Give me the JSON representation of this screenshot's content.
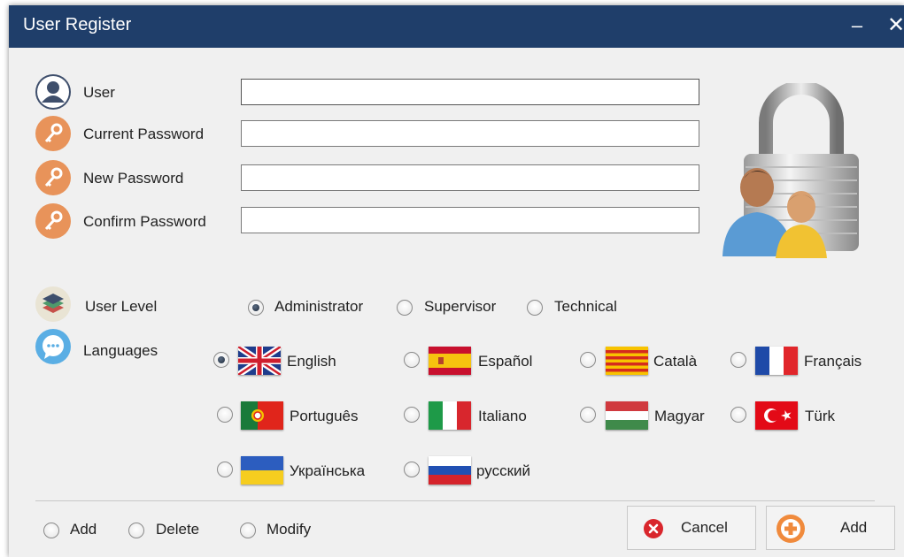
{
  "window": {
    "title": "User Register",
    "minimize_glyph": "–",
    "close_glyph": "✕"
  },
  "fields": {
    "user": {
      "label": "User",
      "value": "",
      "icon": "user-icon"
    },
    "current_password": {
      "label": "Current Password",
      "value": "",
      "icon": "key-icon"
    },
    "new_password": {
      "label": "New Password",
      "value": "",
      "icon": "key-icon"
    },
    "confirm_password": {
      "label": "Confirm Password",
      "value": "",
      "icon": "key-icon"
    }
  },
  "user_level": {
    "label": "User Level",
    "icon": "layers-icon",
    "options": [
      "Administrator",
      "Supervisor",
      "Technical"
    ],
    "selected": "Administrator"
  },
  "languages": {
    "label": "Languages",
    "icon": "chat-bubble-icon",
    "options": [
      "English",
      "Español",
      "Català",
      "Français",
      "Português",
      "Italiano",
      "Magyar",
      "Türk",
      "Українська",
      "русский"
    ],
    "selected": "English"
  },
  "mode": {
    "options": [
      "Add",
      "Delete",
      "Modify"
    ],
    "selected": ""
  },
  "buttons": {
    "cancel": "Cancel",
    "add": "Add"
  },
  "colors": {
    "titlebar": "#1f3e6a",
    "icon_orange": "#e8935a",
    "cancel_red": "#d9262c",
    "add_orange": "#f08a3c"
  }
}
